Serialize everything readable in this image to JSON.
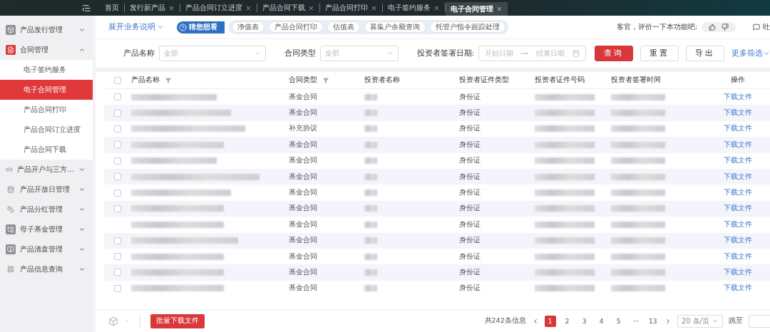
{
  "top_tabs": [
    {
      "label": "首页",
      "closable": false,
      "selected": false
    },
    {
      "label": "发行新产品",
      "closable": true,
      "selected": false
    },
    {
      "label": "产品合同订立进度",
      "closable": true,
      "selected": false
    },
    {
      "label": "产品合同下载",
      "closable": true,
      "selected": false
    },
    {
      "label": "产品合同打印",
      "closable": true,
      "selected": false
    },
    {
      "label": "电子签约服务",
      "closable": true,
      "selected": false
    },
    {
      "label": "电子合同管理",
      "closable": true,
      "selected": true
    }
  ],
  "sidebar": {
    "items": [
      {
        "label": "产品发行管理",
        "expanded": false
      },
      {
        "label": "合同管理",
        "expanded": true,
        "children": [
          {
            "label": "电子签约服务",
            "selected": false
          },
          {
            "label": "电子合同管理",
            "selected": true
          },
          {
            "label": "产品合同打印",
            "selected": false
          },
          {
            "label": "产品合同订立进度",
            "selected": false
          },
          {
            "label": "产品合同下载",
            "selected": false
          }
        ]
      },
      {
        "label": "产品开户与三方...",
        "expanded": false
      },
      {
        "label": "产品开放日管理",
        "expanded": false
      },
      {
        "label": "产品分红管理",
        "expanded": false
      },
      {
        "label": "母子基金管理",
        "expanded": false
      },
      {
        "label": "产品清盘管理",
        "expanded": false
      },
      {
        "label": "产品信息查询",
        "expanded": false
      }
    ]
  },
  "help_bar": {
    "toggle": "展开业务说明",
    "guess_label": "猜您想看",
    "chips": [
      "净值表",
      "产品合同打印",
      "估值表",
      "募集户余额查询",
      "托管户指令跟踪处理"
    ],
    "rating_prompt": "客官，评价一下本功能吧:",
    "feedback": "吐"
  },
  "filters": {
    "product_name": {
      "label": "产品名称",
      "placeholder": "全部"
    },
    "contract_type": {
      "label": "合同类型",
      "placeholder": "全部"
    },
    "sign_date": {
      "label": "投资者签署日期:",
      "start_placeholder": "开始日期",
      "end_placeholder": "结束日期"
    },
    "buttons": [
      {
        "label": "查询",
        "kind": "primary"
      },
      {
        "label": "重置",
        "kind": "default"
      },
      {
        "label": "导出",
        "kind": "default"
      }
    ],
    "more": "更多筛选"
  },
  "table": {
    "all_checked": false,
    "columns": [
      "产品名称",
      "合同类型",
      "投资者名称",
      "投资者证件类型",
      "投资者证件号码",
      "投资者签署时间",
      "操作"
    ],
    "rows": [
      {
        "checked": false,
        "contract_type": "基金合同",
        "id_type": "身份证",
        "action": "下载文件"
      },
      {
        "checked": false,
        "contract_type": "基金合同",
        "id_type": "身份证",
        "action": "下载文件"
      },
      {
        "checked": false,
        "contract_type": "补充协议",
        "id_type": "身份证",
        "action": "下载文件"
      },
      {
        "checked": false,
        "contract_type": "基金合同",
        "id_type": "身份证",
        "action": "下载文件"
      },
      {
        "checked": false,
        "contract_type": "基金合同",
        "id_type": "身份证",
        "action": "下载文件"
      },
      {
        "checked": false,
        "contract_type": "基金合同",
        "id_type": "身份证",
        "action": "下载文件"
      },
      {
        "checked": false,
        "contract_type": "基金合同",
        "id_type": "身份证",
        "action": "下载文件"
      },
      {
        "checked": false,
        "contract_type": "基金合同",
        "id_type": "身份证",
        "action": "下载文件"
      },
      {
        "contract_type": "基金合同",
        "id_type": "身份证",
        "action": "下载文件"
      },
      {
        "checked": false,
        "contract_type": "基金合同",
        "id_type": "身份证",
        "action": "下载文件"
      },
      {
        "checked": false,
        "contract_type": "基金合同",
        "id_type": "身份证",
        "action": "下载文件"
      },
      {
        "checked": false,
        "contract_type": "基金合同",
        "id_type": "身份证",
        "action": "下载文件"
      },
      {
        "checked": false,
        "contract_type": "基金合同",
        "id_type": "身份证",
        "action": "下载文件"
      }
    ]
  },
  "footer": {
    "batch_button": "批量下载文件",
    "total": "共242条信息",
    "pages": [
      {
        "label": "1",
        "selected": true
      },
      {
        "label": "2",
        "selected": false
      },
      {
        "label": "3",
        "selected": false
      },
      {
        "label": "4",
        "selected": false
      },
      {
        "label": "5",
        "selected": false
      },
      {
        "label": "···",
        "selected": false
      },
      {
        "label": "13",
        "selected": false
      }
    ],
    "page_size": "20 条/页",
    "jump_label": "跳至"
  }
}
